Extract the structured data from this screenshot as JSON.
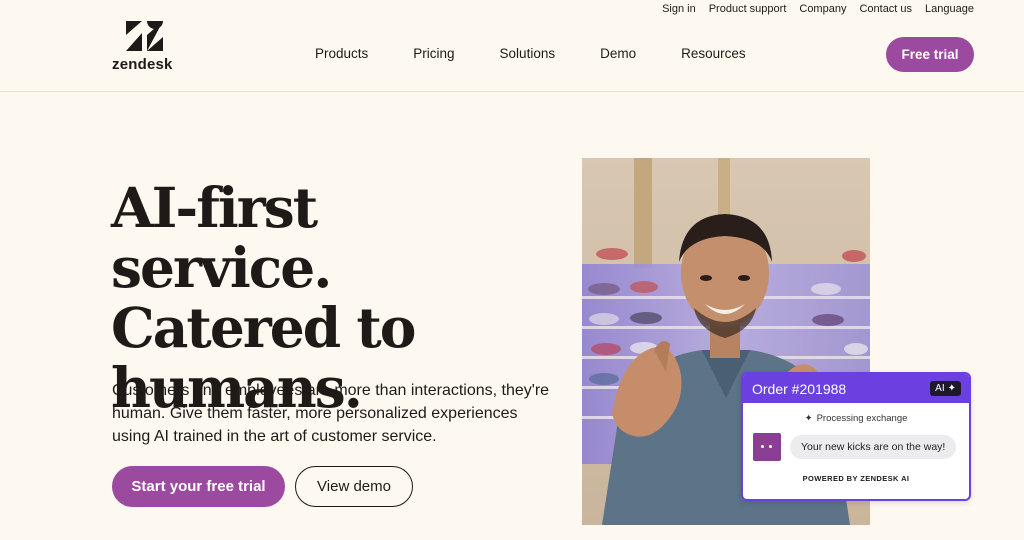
{
  "utility_nav": [
    "Sign in",
    "Product support",
    "Company",
    "Contact us",
    "Language"
  ],
  "brand": {
    "wordmark": "zendesk"
  },
  "main_nav": [
    "Products",
    "Pricing",
    "Solutions",
    "Demo",
    "Resources"
  ],
  "header_cta": "Free trial",
  "hero": {
    "title_lines": [
      "AI-first service.",
      "Catered to",
      "humans."
    ],
    "subtitle": "Customers and employees are more than interactions, they're human. Give them faster, more personalized experiences using AI trained in the art of customer service.",
    "primary_cta": "Start your free trial",
    "secondary_cta": "View demo"
  },
  "order_card": {
    "title": "Order #201988",
    "badge": "AI",
    "status": "Processing exchange",
    "message": "Your new kicks are on the way!",
    "footer": "POWERED BY ZENDESK AI"
  },
  "colors": {
    "background": "#fdf9f1",
    "brand_purple": "#9b4aa0",
    "card_accent": "#6b3fe0",
    "text": "#1f1a17"
  }
}
